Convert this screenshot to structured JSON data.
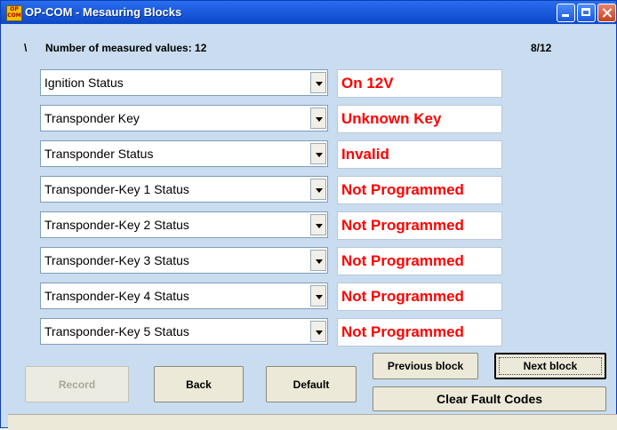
{
  "window": {
    "title": "OP-COM - Mesauring Blocks",
    "icon_label": "OP COM"
  },
  "header": {
    "marker": "\\",
    "count_label": "Number of measured values: 12",
    "page_indicator": "8/12"
  },
  "rows": [
    {
      "name": "Ignition Status",
      "value": "On  12V"
    },
    {
      "name": "Transponder Key",
      "value": "Unknown Key"
    },
    {
      "name": "Transponder Status",
      "value": "Invalid"
    },
    {
      "name": "Transponder-Key 1 Status",
      "value": "Not Programmed"
    },
    {
      "name": "Transponder-Key 2 Status",
      "value": "Not Programmed"
    },
    {
      "name": "Transponder-Key 3 Status",
      "value": "Not Programmed"
    },
    {
      "name": "Transponder-Key 4 Status",
      "value": "Not Programmed"
    },
    {
      "name": "Transponder-Key 5 Status",
      "value": "Not Programmed"
    }
  ],
  "buttons": {
    "record": "Record",
    "back": "Back",
    "default": "Default",
    "previous_block": "Previous block",
    "next_block": "Next block",
    "clear_fault_codes": "Clear Fault Codes"
  },
  "colors": {
    "value_text": "#ff0000",
    "background": "#c9dcf0",
    "title_bar": "#1e5fe0"
  }
}
